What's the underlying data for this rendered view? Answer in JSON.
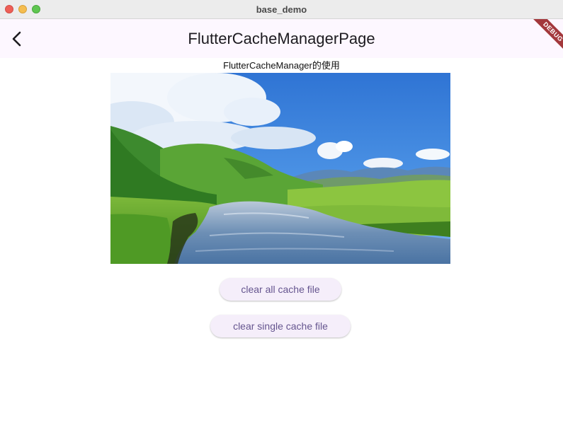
{
  "window": {
    "title": "base_demo"
  },
  "appbar": {
    "title": "FlutterCacheManagerPage",
    "back_icon": "chevron-left-icon"
  },
  "debug_banner": {
    "label": "DEBUG",
    "color": "#a3383c"
  },
  "content": {
    "caption": "FlutterCacheManager的使用",
    "image_description": "landscape-photo"
  },
  "buttons": {
    "clear_all_label": "clear all cache file",
    "clear_single_label": "clear single cache file"
  },
  "colors": {
    "appbar_bg": "#fdf7ff",
    "button_bg": "#f5eefa",
    "button_text": "#65558f"
  }
}
